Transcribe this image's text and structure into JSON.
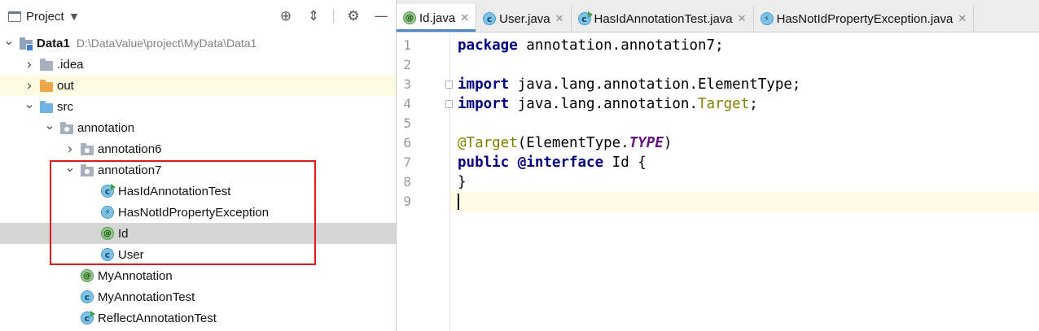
{
  "project_panel": {
    "title": "Project",
    "tools": [
      "crosshair-icon",
      "collapse-icon",
      "gear-icon",
      "minimize-icon"
    ]
  },
  "tree": [
    {
      "label": "Data1",
      "path": "D:\\DataValue\\project\\MyData\\Data1",
      "arrow": "down",
      "icon": "module-folder-icon",
      "depth": 0,
      "bold": true
    },
    {
      "label": ".idea",
      "arrow": "right",
      "icon": "folder-icon",
      "depth": 1
    },
    {
      "label": "out",
      "arrow": "right",
      "icon": "excluded-folder-icon",
      "depth": 1,
      "highlight": "yellow"
    },
    {
      "label": "src",
      "arrow": "down",
      "icon": "source-folder-icon",
      "depth": 1
    },
    {
      "label": "annotation",
      "arrow": "down",
      "icon": "package-icon",
      "depth": 2
    },
    {
      "label": "annotation6",
      "arrow": "right",
      "icon": "package-icon",
      "depth": 3
    },
    {
      "label": "annotation7",
      "arrow": "down",
      "icon": "package-icon",
      "depth": 3
    },
    {
      "label": "HasIdAnnotationTest",
      "arrow": "none",
      "icon": "test-class-icon",
      "depth": 4
    },
    {
      "label": "HasNotIdPropertyException",
      "arrow": "none",
      "icon": "exception-class-icon",
      "depth": 4
    },
    {
      "label": "Id",
      "arrow": "none",
      "icon": "annotation-icon",
      "depth": 4,
      "highlight": "selected"
    },
    {
      "label": "User",
      "arrow": "none",
      "icon": "class-icon",
      "depth": 4
    },
    {
      "label": "MyAnnotation",
      "arrow": "none",
      "icon": "annotation-icon",
      "depth": 3
    },
    {
      "label": "MyAnnotationTest",
      "arrow": "none",
      "icon": "class-icon",
      "depth": 3
    },
    {
      "label": "ReflectAnnotationTest",
      "arrow": "none",
      "icon": "test-class-icon",
      "depth": 3
    }
  ],
  "tabs": [
    {
      "label": "Id.java",
      "icon": "annotation-icon",
      "active": true
    },
    {
      "label": "User.java",
      "icon": "class-icon"
    },
    {
      "label": "HasIdAnnotationTest.java",
      "icon": "test-class-icon"
    },
    {
      "label": "HasNotIdPropertyException.java",
      "icon": "exception-class-icon"
    }
  ],
  "editor": {
    "line_numbers": [
      "1",
      "2",
      "3",
      "4",
      "5",
      "6",
      "7",
      "8",
      "9"
    ],
    "current_line": 9,
    "lines": [
      [
        {
          "t": "package",
          "c": "kw"
        },
        {
          "t": " annotation.annotation7;"
        }
      ],
      [],
      [
        {
          "t": "import",
          "c": "kw"
        },
        {
          "t": " java.lang.annotation.ElementType;"
        }
      ],
      [
        {
          "t": "import",
          "c": "kw"
        },
        {
          "t": " java.lang.annotation."
        },
        {
          "t": "Target",
          "c": "ann"
        },
        {
          "t": ";"
        }
      ],
      [],
      [
        {
          "t": "@Target",
          "c": "ann"
        },
        {
          "t": "(ElementType."
        },
        {
          "t": "TYPE",
          "c": "sfield"
        },
        {
          "t": ")"
        }
      ],
      [
        {
          "t": "public",
          "c": "kw"
        },
        {
          "t": " "
        },
        {
          "t": "@interface",
          "c": "kw"
        },
        {
          "t": " Id {"
        }
      ],
      [
        {
          "t": "}"
        }
      ],
      []
    ]
  },
  "colors": {
    "selection_box": "#e0191c",
    "accent": "#4a88c7"
  }
}
